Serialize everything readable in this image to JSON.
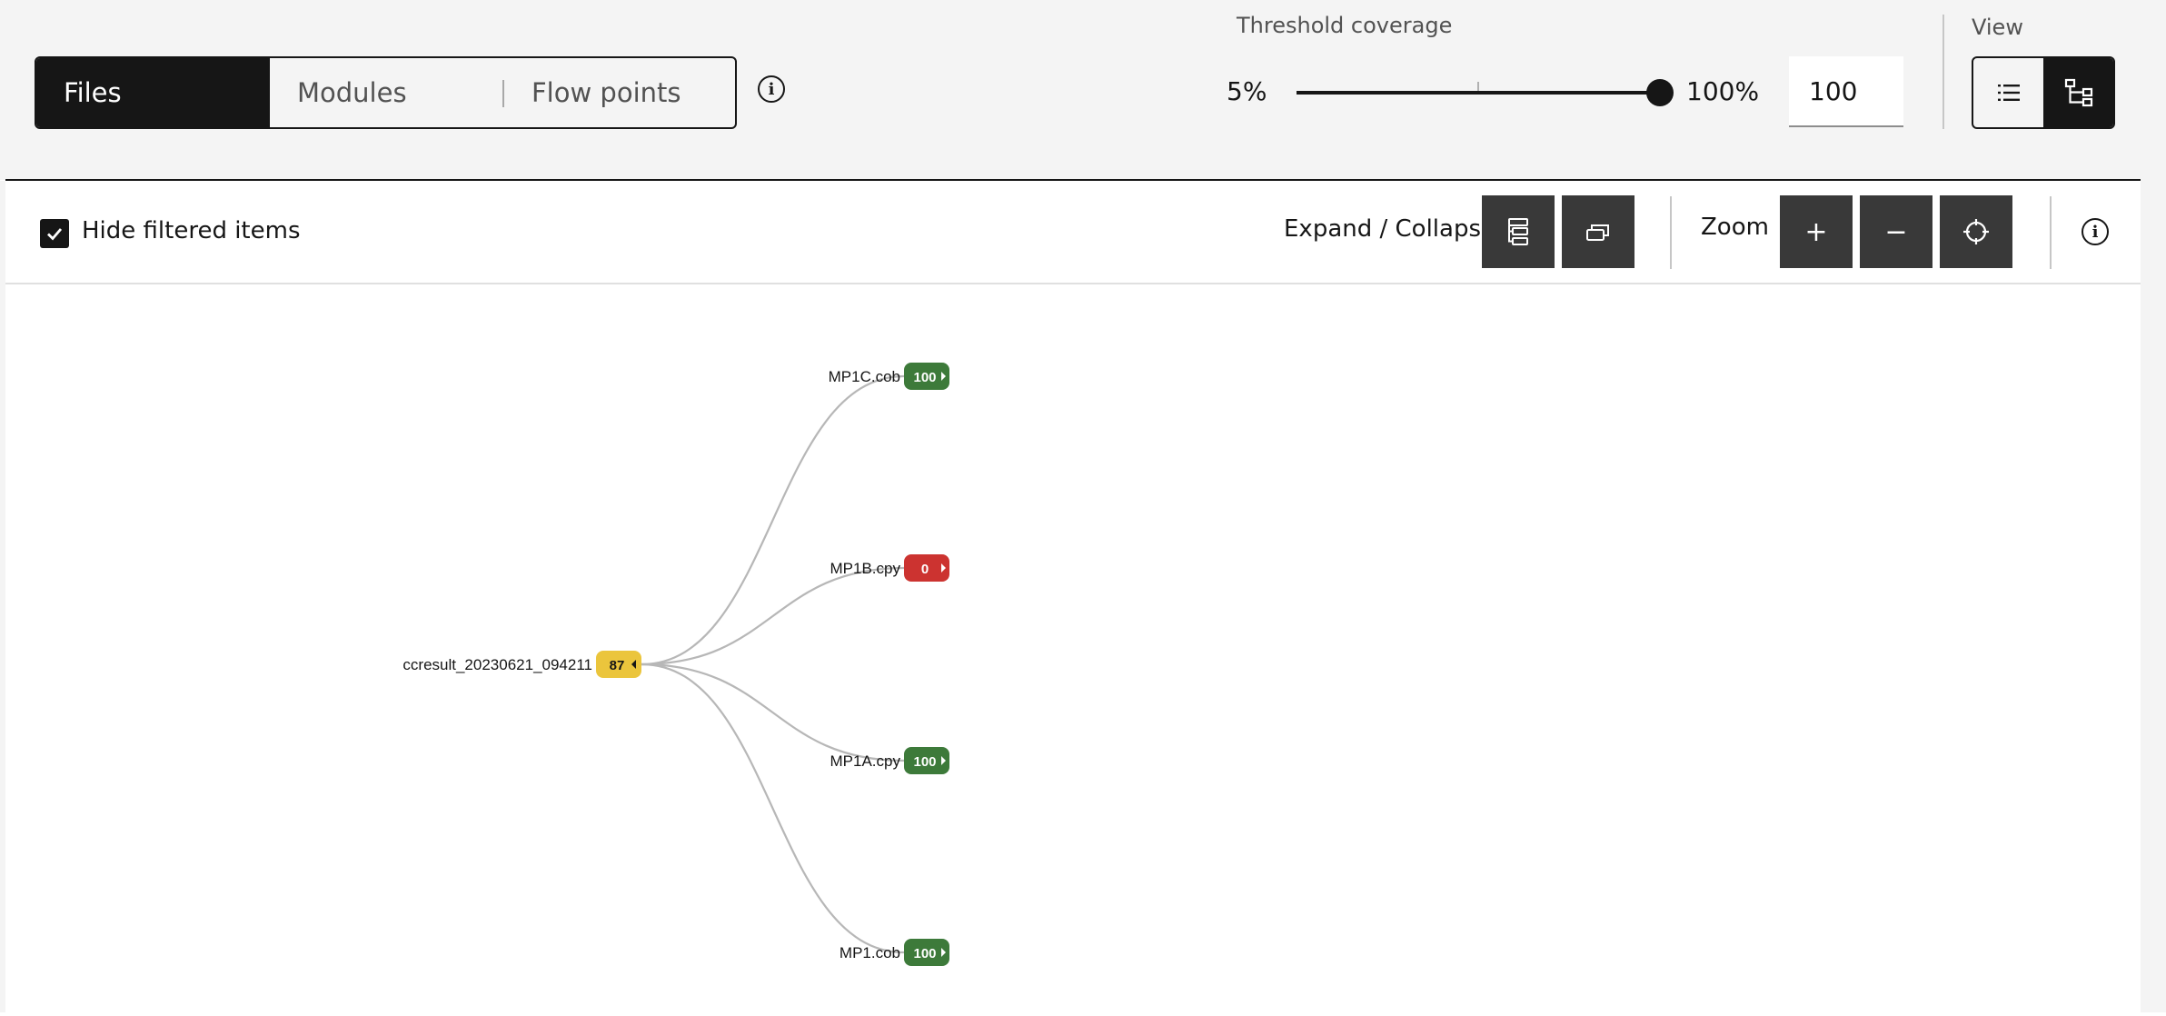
{
  "switcher": {
    "tabs": [
      {
        "label": "Files",
        "active": true
      },
      {
        "label": "Modules",
        "active": false
      },
      {
        "label": "Flow points",
        "active": false
      }
    ]
  },
  "threshold": {
    "label": "Threshold coverage",
    "min_label": "5%",
    "max_label": "100%",
    "value": "100",
    "level_fraction": 1.0
  },
  "view": {
    "label": "View",
    "options": [
      {
        "icon": "list-icon",
        "active": false
      },
      {
        "icon": "tree-icon",
        "active": true
      }
    ]
  },
  "toolbar": {
    "hide_filtered_label": "Hide filtered items",
    "hide_filtered_checked": true,
    "expand_collapse_label": "Expand / Collapse",
    "zoom_label": "Zoom",
    "zoom_in_symbol": "+",
    "zoom_out_symbol": "−"
  },
  "tree": {
    "root": {
      "label": "ccresult_20230621_094211",
      "value": "87",
      "status": "warning"
    },
    "children": [
      {
        "label": "MP1C.cob",
        "value": "100",
        "status": "good"
      },
      {
        "label": "MP1B.cpy",
        "value": "0",
        "status": "bad"
      },
      {
        "label": "MP1A.cpy",
        "value": "100",
        "status": "good"
      },
      {
        "label": "MP1.cob",
        "value": "100",
        "status": "good"
      }
    ]
  },
  "colors": {
    "good": "#3d7a3a",
    "bad": "#cc3330",
    "warning": "#ebc53c",
    "link": "#b7b7b7",
    "dark": "#161616",
    "button": "#393939"
  }
}
